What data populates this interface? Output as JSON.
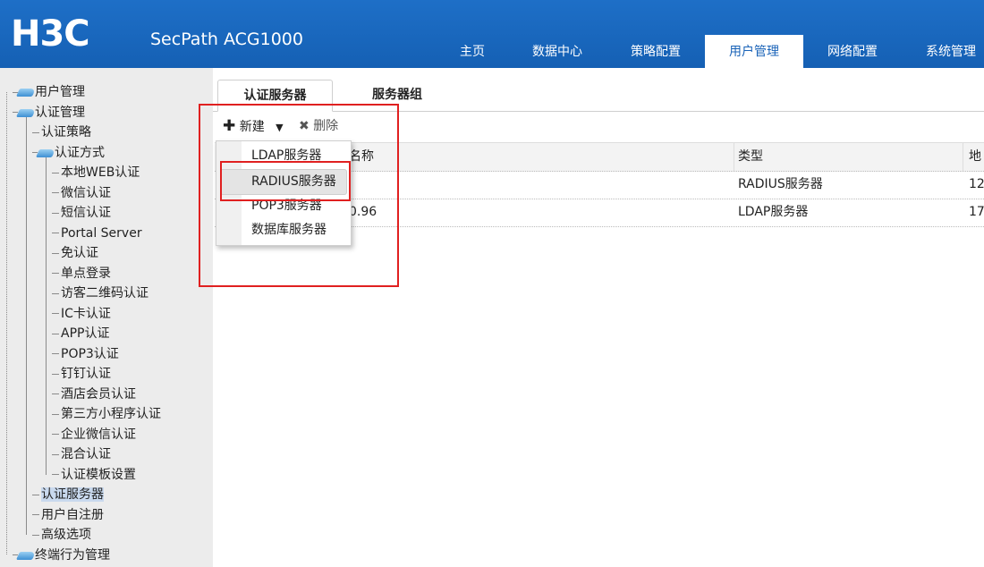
{
  "header": {
    "logo": "H3C",
    "product": "SecPath ACG1000",
    "nav": [
      "主页",
      "数据中心",
      "策略配置",
      "用户管理",
      "网络配置",
      "系统管理"
    ],
    "nav_active": "用户管理"
  },
  "sidebar": {
    "items": [
      {
        "label": "用户管理",
        "folder": true
      },
      {
        "label": "认证管理",
        "folder": true
      },
      {
        "label": "认证策略",
        "folder": false
      },
      {
        "label": "认证方式",
        "folder": true
      },
      {
        "label": "本地WEB认证",
        "folder": false
      },
      {
        "label": "微信认证",
        "folder": false
      },
      {
        "label": "短信认证",
        "folder": false
      },
      {
        "label": "Portal Server",
        "folder": false
      },
      {
        "label": "免认证",
        "folder": false
      },
      {
        "label": "单点登录",
        "folder": false
      },
      {
        "label": "访客二维码认证",
        "folder": false
      },
      {
        "label": "IC卡认证",
        "folder": false
      },
      {
        "label": "APP认证",
        "folder": false
      },
      {
        "label": "POP3认证",
        "folder": false
      },
      {
        "label": "钉钉认证",
        "folder": false
      },
      {
        "label": "酒店会员认证",
        "folder": false
      },
      {
        "label": "第三方小程序认证",
        "folder": false
      },
      {
        "label": "企业微信认证",
        "folder": false
      },
      {
        "label": "混合认证",
        "folder": false
      },
      {
        "label": "认证模板设置",
        "folder": false
      },
      {
        "label": "认证服务器",
        "folder": false,
        "selected": true
      },
      {
        "label": "用户自注册",
        "folder": false
      },
      {
        "label": "高级选项",
        "folder": false
      },
      {
        "label": "终端行为管理",
        "folder": true
      }
    ]
  },
  "tabs": [
    "认证服务器",
    "服务器组"
  ],
  "toolbar": {
    "new_label": "新建",
    "delete_label": "删除"
  },
  "table": {
    "columns": [
      "名称",
      "类型",
      "地址"
    ],
    "columns_visible": [
      "名称",
      "类型",
      "地"
    ],
    "rows": [
      {
        "name": "",
        "type": "RADIUS服务器",
        "addr": "12"
      },
      {
        "name": "0.96",
        "type": "LDAP服务器",
        "addr": "17"
      }
    ]
  },
  "dropdown": {
    "items": [
      "LDAP服务器",
      "RADIUS服务器",
      "POP3服务器",
      "数据库服务器"
    ],
    "hovered": "RADIUS服务器"
  },
  "colors": {
    "header_blue": "#1b67be",
    "highlight_red": "#e02020",
    "selected_bg": "#c9d9ee"
  }
}
